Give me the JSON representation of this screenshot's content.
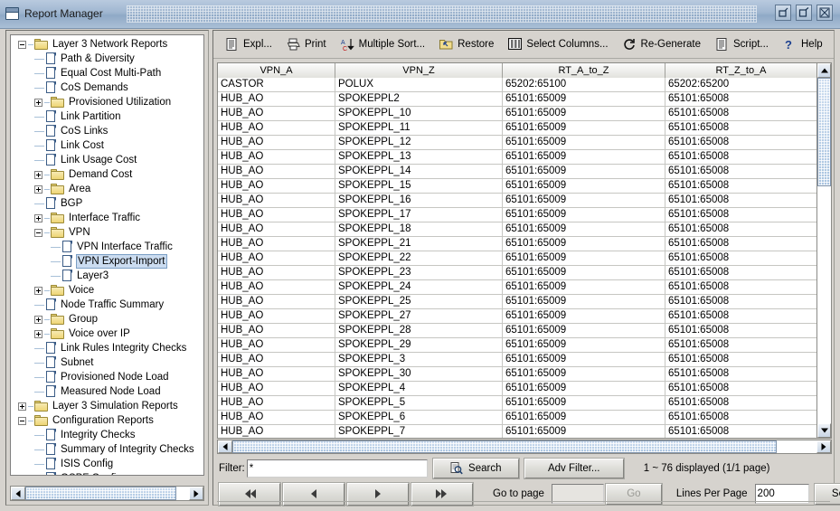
{
  "window": {
    "title": "Report Manager",
    "icon": "window-icon",
    "buttons": [
      {
        "name": "minimize-button",
        "glyph": "minimize"
      },
      {
        "name": "maximize-button",
        "glyph": "maximize"
      },
      {
        "name": "close-button",
        "glyph": "close"
      }
    ]
  },
  "sidebar": {
    "items": [
      {
        "label": "Layer 3 Network Reports",
        "type": "folder",
        "depth": 0,
        "toggle": "minus"
      },
      {
        "label": "Path & Diversity",
        "type": "doc",
        "depth": 1,
        "toggle": "none"
      },
      {
        "label": "Equal Cost Multi-Path",
        "type": "doc",
        "depth": 1,
        "toggle": "none"
      },
      {
        "label": "CoS Demands",
        "type": "doc",
        "depth": 1,
        "toggle": "none"
      },
      {
        "label": "Provisioned Utilization",
        "type": "folder",
        "depth": 1,
        "toggle": "plus"
      },
      {
        "label": "Link Partition",
        "type": "doc",
        "depth": 1,
        "toggle": "none"
      },
      {
        "label": "CoS Links",
        "type": "doc",
        "depth": 1,
        "toggle": "none"
      },
      {
        "label": "Link Cost",
        "type": "doc",
        "depth": 1,
        "toggle": "none"
      },
      {
        "label": "Link Usage Cost",
        "type": "doc",
        "depth": 1,
        "toggle": "none"
      },
      {
        "label": "Demand Cost",
        "type": "folder",
        "depth": 1,
        "toggle": "plus"
      },
      {
        "label": "Area",
        "type": "folder",
        "depth": 1,
        "toggle": "plus"
      },
      {
        "label": "BGP",
        "type": "doc",
        "depth": 1,
        "toggle": "none"
      },
      {
        "label": "Interface Traffic",
        "type": "folder",
        "depth": 1,
        "toggle": "plus"
      },
      {
        "label": "VPN",
        "type": "folder",
        "depth": 1,
        "toggle": "minus"
      },
      {
        "label": "VPN Interface Traffic",
        "type": "doc",
        "depth": 2,
        "toggle": "none"
      },
      {
        "label": "VPN Export-Import",
        "type": "doc",
        "depth": 2,
        "toggle": "none",
        "selected": true
      },
      {
        "label": "Layer3",
        "type": "doc",
        "depth": 2,
        "toggle": "none"
      },
      {
        "label": "Voice",
        "type": "folder",
        "depth": 1,
        "toggle": "plus"
      },
      {
        "label": "Node Traffic Summary",
        "type": "doc",
        "depth": 1,
        "toggle": "none"
      },
      {
        "label": "Group",
        "type": "folder",
        "depth": 1,
        "toggle": "plus"
      },
      {
        "label": "Voice over IP",
        "type": "folder",
        "depth": 1,
        "toggle": "plus"
      },
      {
        "label": "Link Rules Integrity Checks",
        "type": "doc",
        "depth": 1,
        "toggle": "none"
      },
      {
        "label": "Subnet",
        "type": "doc",
        "depth": 1,
        "toggle": "none"
      },
      {
        "label": "Provisioned Node Load",
        "type": "doc",
        "depth": 1,
        "toggle": "none"
      },
      {
        "label": "Measured Node Load",
        "type": "doc",
        "depth": 1,
        "toggle": "none"
      },
      {
        "label": "Layer 3 Simulation Reports",
        "type": "folder",
        "depth": 0,
        "toggle": "plus"
      },
      {
        "label": "Configuration Reports",
        "type": "folder",
        "depth": 0,
        "toggle": "minus"
      },
      {
        "label": "Integrity Checks",
        "type": "doc",
        "depth": 1,
        "toggle": "none"
      },
      {
        "label": "Summary of Integrity Checks",
        "type": "doc",
        "depth": 1,
        "toggle": "none"
      },
      {
        "label": "ISIS Config",
        "type": "doc",
        "depth": 1,
        "toggle": "none"
      },
      {
        "label": "OSPF Config",
        "type": "doc",
        "depth": 1,
        "toggle": "none"
      }
    ]
  },
  "toolbar": {
    "items": [
      {
        "label": "Expl...",
        "icon": "document-icon",
        "name": "explore-button"
      },
      {
        "label": "Print",
        "icon": "printer-icon",
        "name": "print-button"
      },
      {
        "label": "Multiple Sort...",
        "icon": "sort-az-icon",
        "name": "multiple-sort-button"
      },
      {
        "label": "Restore",
        "icon": "restore-folder-icon",
        "name": "restore-button"
      },
      {
        "label": "Select Columns...",
        "icon": "columns-icon",
        "name": "select-columns-button"
      },
      {
        "label": "Re-Generate",
        "icon": "refresh-icon",
        "name": "regenerate-button"
      },
      {
        "label": "Script...",
        "icon": "script-icon",
        "name": "script-button"
      },
      {
        "label": "Help",
        "icon": "question-icon",
        "name": "help-button"
      }
    ]
  },
  "table": {
    "columns": [
      "VPN_A",
      "VPN_Z",
      "RT_A_to_Z",
      "RT_Z_to_A"
    ],
    "rows": [
      [
        "CASTOR",
        "POLUX",
        "65202:65100",
        "65202:65200"
      ],
      [
        "HUB_AO",
        "SPOKEPPL2",
        "65101:65009",
        "65101:65008"
      ],
      [
        "HUB_AO",
        "SPOKEPPL_10",
        "65101:65009",
        "65101:65008"
      ],
      [
        "HUB_AO",
        "SPOKEPPL_11",
        "65101:65009",
        "65101:65008"
      ],
      [
        "HUB_AO",
        "SPOKEPPL_12",
        "65101:65009",
        "65101:65008"
      ],
      [
        "HUB_AO",
        "SPOKEPPL_13",
        "65101:65009",
        "65101:65008"
      ],
      [
        "HUB_AO",
        "SPOKEPPL_14",
        "65101:65009",
        "65101:65008"
      ],
      [
        "HUB_AO",
        "SPOKEPPL_15",
        "65101:65009",
        "65101:65008"
      ],
      [
        "HUB_AO",
        "SPOKEPPL_16",
        "65101:65009",
        "65101:65008"
      ],
      [
        "HUB_AO",
        "SPOKEPPL_17",
        "65101:65009",
        "65101:65008"
      ],
      [
        "HUB_AO",
        "SPOKEPPL_18",
        "65101:65009",
        "65101:65008"
      ],
      [
        "HUB_AO",
        "SPOKEPPL_21",
        "65101:65009",
        "65101:65008"
      ],
      [
        "HUB_AO",
        "SPOKEPPL_22",
        "65101:65009",
        "65101:65008"
      ],
      [
        "HUB_AO",
        "SPOKEPPL_23",
        "65101:65009",
        "65101:65008"
      ],
      [
        "HUB_AO",
        "SPOKEPPL_24",
        "65101:65009",
        "65101:65008"
      ],
      [
        "HUB_AO",
        "SPOKEPPL_25",
        "65101:65009",
        "65101:65008"
      ],
      [
        "HUB_AO",
        "SPOKEPPL_27",
        "65101:65009",
        "65101:65008"
      ],
      [
        "HUB_AO",
        "SPOKEPPL_28",
        "65101:65009",
        "65101:65008"
      ],
      [
        "HUB_AO",
        "SPOKEPPL_29",
        "65101:65009",
        "65101:65008"
      ],
      [
        "HUB_AO",
        "SPOKEPPL_3",
        "65101:65009",
        "65101:65008"
      ],
      [
        "HUB_AO",
        "SPOKEPPL_30",
        "65101:65009",
        "65101:65008"
      ],
      [
        "HUB_AO",
        "SPOKEPPL_4",
        "65101:65009",
        "65101:65008"
      ],
      [
        "HUB_AO",
        "SPOKEPPL_5",
        "65101:65009",
        "65101:65008"
      ],
      [
        "HUB_AO",
        "SPOKEPPL_6",
        "65101:65009",
        "65101:65008"
      ],
      [
        "HUB_AO",
        "SPOKEPPL_7",
        "65101:65009",
        "65101:65008"
      ]
    ]
  },
  "filterbar": {
    "filter_label": "Filter:",
    "filter_value": "*",
    "search_label": "Search",
    "adv_filter_label": "Adv Filter...",
    "status": "1 ~ 76 displayed (1/1 page)"
  },
  "pagebar": {
    "first_label": "first-page",
    "prev_label": "previous-page",
    "next_label": "next-page",
    "last_label": "last-page",
    "goto_label": "Go to page",
    "goto_value": "",
    "go_label": "Go",
    "lines_label": "Lines Per Page",
    "lines_value": "200",
    "set_label": "Set"
  },
  "colors": {
    "title_gradient_top": "#b9cadf",
    "title_gradient_bottom": "#8fa9c6",
    "panel_bg": "#d6d3ce",
    "selection": "#cbdcf0",
    "folder": "#eed574",
    "scroll_thumb": "#a9c4e0"
  }
}
